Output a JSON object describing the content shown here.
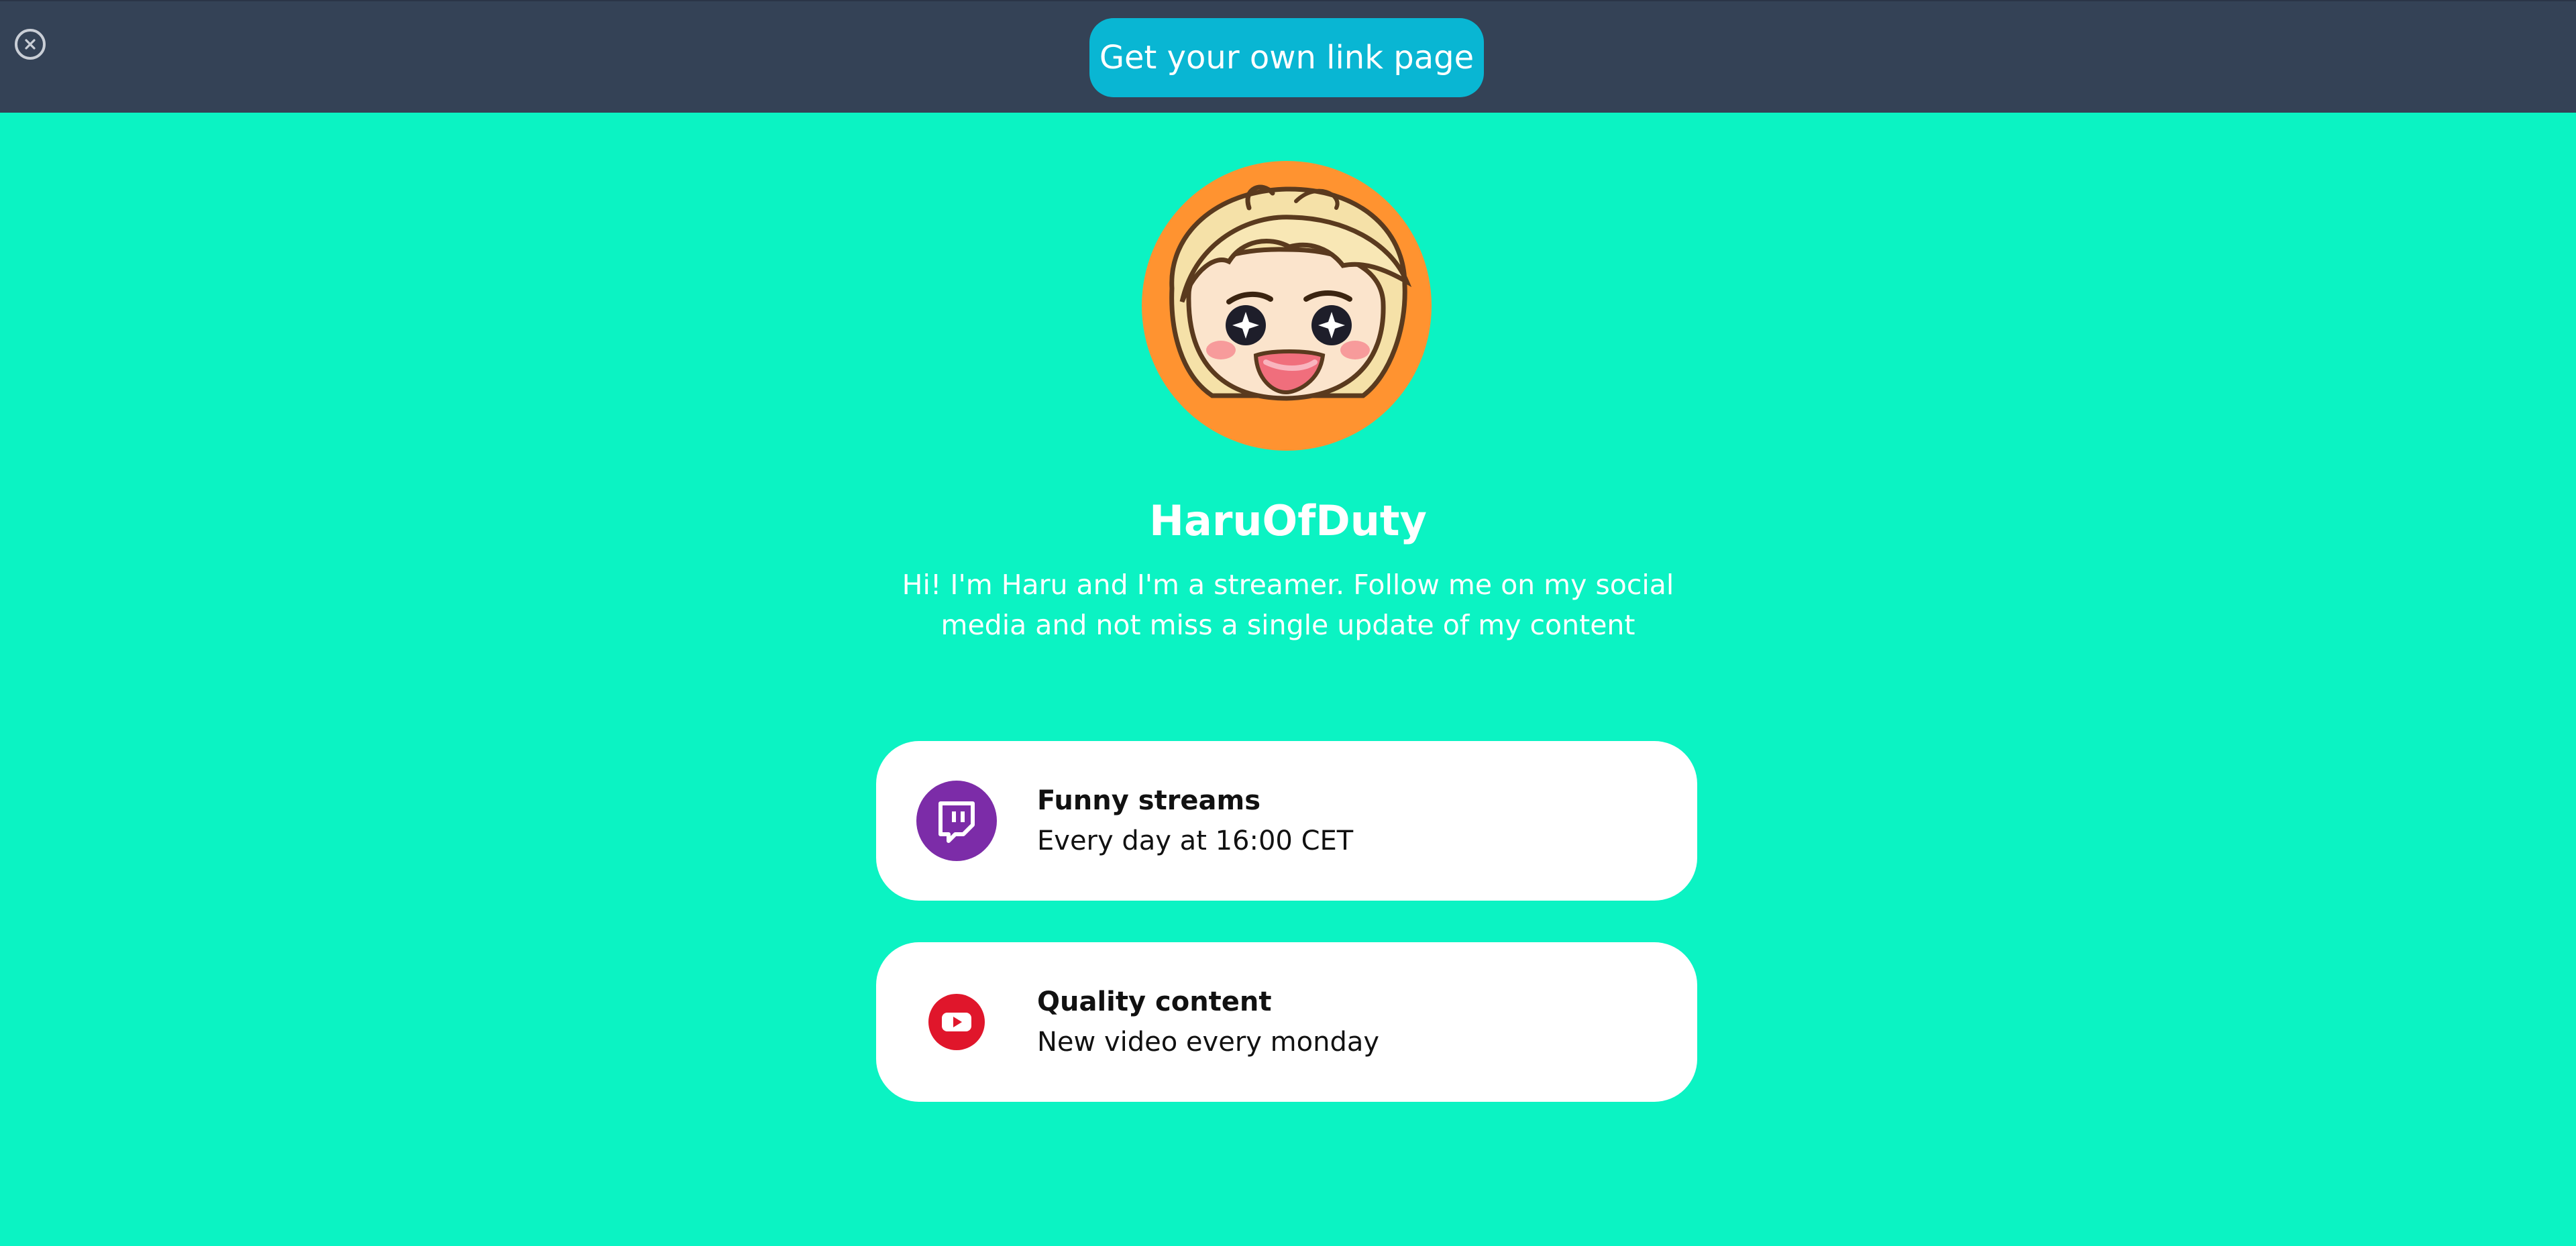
{
  "banner": {
    "cta_label": "Get your own link page"
  },
  "profile": {
    "name": "HaruOfDuty",
    "bio": "Hi! I'm Haru and I'm a streamer. Follow me on my social media and not miss a single update of my content"
  },
  "links": [
    {
      "title": "Funny streams",
      "subtitle": "Every day at 16:00 CET",
      "icon": "twitch-icon"
    },
    {
      "title": "Quality content",
      "subtitle": "New video every monday",
      "icon": "youtube-icon"
    }
  ],
  "colors": {
    "page_background": "#0BF3C3",
    "topbar": "#344256",
    "cta": "#09B6D3",
    "avatar_ring": "#FF9330",
    "twitch": "#7C2CA8",
    "youtube": "#E0162B"
  }
}
